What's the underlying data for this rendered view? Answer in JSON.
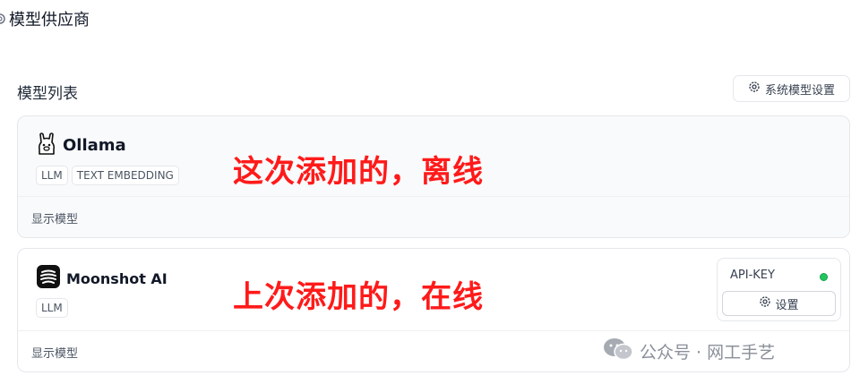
{
  "page": {
    "title": "模型供应商"
  },
  "section": {
    "title": "模型列表"
  },
  "toolbar": {
    "system_settings_label": "系统模型设置"
  },
  "providers": [
    {
      "name": "Ollama",
      "tags": [
        "LLM",
        "TEXT EMBEDDING"
      ],
      "annotation": "这次添加的，离线",
      "show_models_label": "显示模型"
    },
    {
      "name": "Moonshot AI",
      "tags": [
        "LLM"
      ],
      "annotation": "上次添加的，在线",
      "show_models_label": "显示模型",
      "api_key_label": "API-KEY",
      "settings_label": "设置",
      "status_color": "#22c55e"
    }
  ],
  "watermark": {
    "text": "公众号 · 网工手艺"
  },
  "colors": {
    "annotation": "#ff1a1a",
    "status_online": "#22c55e"
  }
}
